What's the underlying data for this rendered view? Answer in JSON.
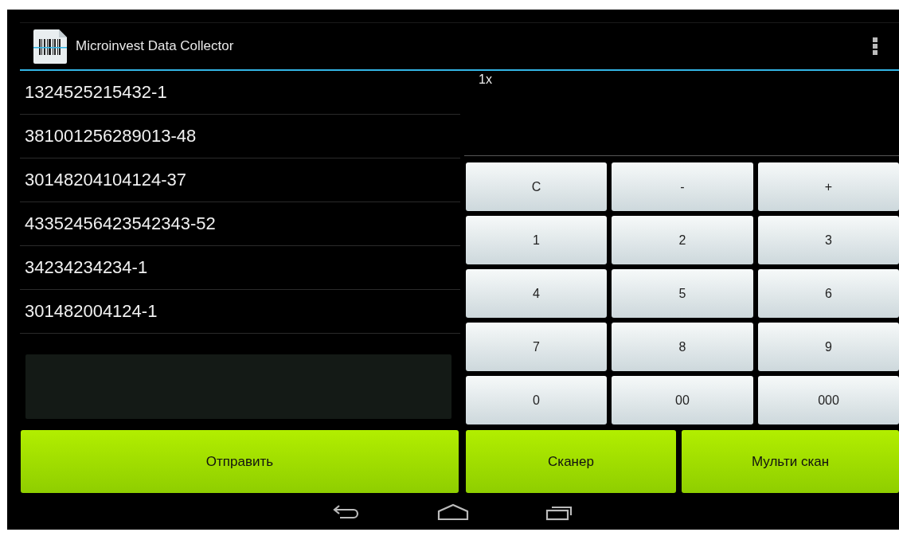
{
  "app_bar": {
    "title": "Microinvest Data Collector"
  },
  "codes": [
    "1324525215432-1",
    "381001256289013-48",
    "30148204104124-37",
    "43352456423542343-52",
    "34234234234-1",
    "301482004124-1"
  ],
  "quantity_display": {
    "value": "1x"
  },
  "keypad": {
    "keys": [
      "C",
      "-",
      "+",
      "1",
      "2",
      "3",
      "4",
      "5",
      "6",
      "7",
      "8",
      "9",
      "0",
      "00",
      "000"
    ]
  },
  "actions": {
    "send": "Отправить",
    "scan": "Сканер",
    "multi_scan": "Мульти скан"
  }
}
